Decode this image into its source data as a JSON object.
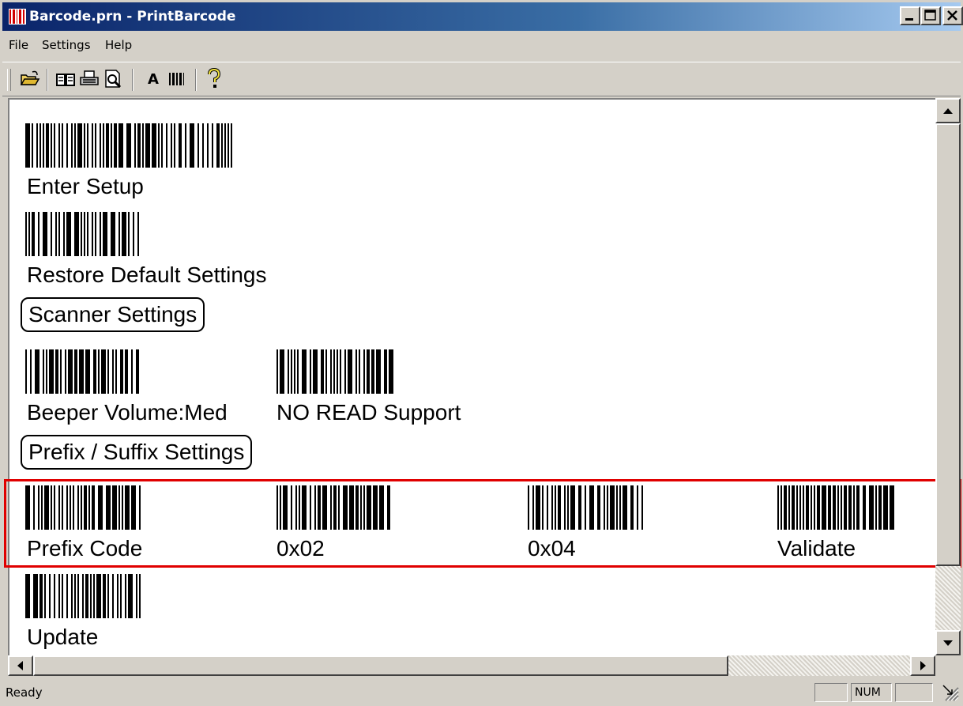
{
  "window": {
    "title": "Barcode.prn - PrintBarcode"
  },
  "menu": {
    "items": [
      "File",
      "Settings",
      "Help"
    ]
  },
  "toolbar": {
    "icons": [
      "open-folder-icon",
      "book-icon",
      "print-icon",
      "print-preview-icon",
      "font-icon",
      "barcode-icon",
      "help-icon"
    ],
    "font_label": "A"
  },
  "content": {
    "enter_setup": "Enter Setup",
    "restore_default": "Restore Default Settings",
    "scanner_settings": "Scanner Settings",
    "beeper_volume": "Beeper Volume:Med",
    "no_read": "NO READ Support",
    "prefix_suffix_settings": "Prefix / Suffix Settings",
    "prefix_code": "Prefix Code",
    "code_0x02": "0x02",
    "code_0x04": "0x04",
    "validate": "Validate",
    "update": "Update"
  },
  "highlight_color": "#e00000",
  "status": {
    "text": "Ready",
    "num": "NUM"
  }
}
